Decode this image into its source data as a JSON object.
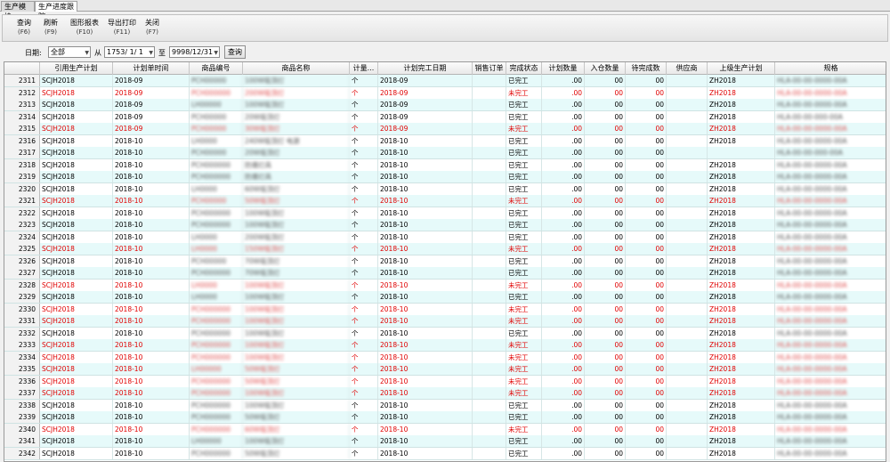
{
  "tabs": [
    {
      "label": "生产模块"
    },
    {
      "label": "生产进度跟踪"
    }
  ],
  "toolbar": {
    "buttons": [
      {
        "label": "查询",
        "key": "(F6)"
      },
      {
        "label": "刷新",
        "key": "(F9)"
      },
      {
        "label": "图形报表",
        "key": "(F10)"
      },
      {
        "label": "导出打印",
        "key": "(F11)"
      },
      {
        "label": "关闭",
        "key": "(F7)"
      }
    ]
  },
  "filter": {
    "date_label": "日期:",
    "range_value": "全部",
    "from_label": "从",
    "from_date": "1753/ 1/ 1",
    "to_label": "至",
    "to_date": "9998/12/31",
    "query_label": "查询"
  },
  "columns": [
    "引用生产计划",
    "计划单时间",
    "商品编号",
    "商品名称",
    "计量...",
    "计划完工日期",
    "销售订单",
    "完成状态",
    "计划数量",
    "入仓数量",
    "待完成数",
    "供应商",
    "上级生产计划",
    "规格"
  ],
  "rows": [
    {
      "n": "2311",
      "plan": "SCJH2018",
      "time": "2018-09",
      "code": "PCH00000",
      "name": "100W吸顶灯",
      "unit": "个",
      "date": "2018-09",
      "status": "已完工",
      "qty": ".00",
      "in": "00",
      "todo": "00",
      "parent": "ZH2018",
      "spec": "HLA-00-00-0000-00A",
      "red": false
    },
    {
      "n": "2312",
      "plan": "SCJH2018",
      "time": "2018-09",
      "code": "PCH000000",
      "name": "200W吸顶灯",
      "unit": "个",
      "date": "2018-09",
      "status": "未完工",
      "qty": ".00",
      "in": "00",
      "todo": "00",
      "parent": "ZH2018",
      "spec": "HLA-00-00-0000-00A",
      "red": true
    },
    {
      "n": "2313",
      "plan": "SCJH2018",
      "time": "2018-09",
      "code": "LH00000",
      "name": "100W吸顶灯",
      "unit": "个",
      "date": "2018-09",
      "status": "已完工",
      "qty": ".00",
      "in": "00",
      "todo": "00",
      "parent": "ZH2018",
      "spec": "HLA-00-00-0000-00A",
      "red": false
    },
    {
      "n": "2314",
      "plan": "SCJH2018",
      "time": "2018-09",
      "code": "PCH00000",
      "name": "20W吸顶灯",
      "unit": "个",
      "date": "2018-09",
      "status": "已完工",
      "qty": ".00",
      "in": "00",
      "todo": "00",
      "parent": "ZH2018",
      "spec": "HLA-00-00-000-00A",
      "red": false
    },
    {
      "n": "2315",
      "plan": "SCJH2018",
      "time": "2018-09",
      "code": "PCH00000",
      "name": "30W吸顶灯",
      "unit": "个",
      "date": "2018-09",
      "status": "未完工",
      "qty": ".00",
      "in": "00",
      "todo": "00",
      "parent": "ZH2018",
      "spec": "HLA-00-00-0000-00A",
      "red": true
    },
    {
      "n": "2316",
      "plan": "SCJH2018",
      "time": "2018-10",
      "code": "LH0000",
      "name": "240W吸顶灯 电源",
      "unit": "个",
      "date": "2018-10",
      "status": "已完工",
      "qty": ".00",
      "in": "00",
      "todo": "00",
      "parent": "ZH2018",
      "spec": "HLA-00-00-0000-00A",
      "red": false
    },
    {
      "n": "2317",
      "plan": "SCJH2018",
      "time": "2018-10",
      "code": "PCH00000",
      "name": "20W吸顶灯",
      "unit": "个",
      "date": "2018-10",
      "status": "已完工",
      "qty": ".00",
      "in": "00",
      "todo": "00",
      "parent": "",
      "spec": "HLA-00-00-000-00A",
      "red": false
    },
    {
      "n": "2318",
      "plan": "SCJH2018",
      "time": "2018-10",
      "code": "PCH000000",
      "name": "防爆灯具",
      "unit": "个",
      "date": "2018-10",
      "status": "已完工",
      "qty": ".00",
      "in": "00",
      "todo": "00",
      "parent": "ZH2018",
      "spec": "HLA-00-00-0000-00A",
      "red": false
    },
    {
      "n": "2319",
      "plan": "SCJH2018",
      "time": "2018-10",
      "code": "PCH000000",
      "name": "防爆灯具",
      "unit": "个",
      "date": "2018-10",
      "status": "已完工",
      "qty": ".00",
      "in": "00",
      "todo": "00",
      "parent": "ZH2018",
      "spec": "HLA-00-00-0000-00A",
      "red": false
    },
    {
      "n": "2320",
      "plan": "SCJH2018",
      "time": "2018-10",
      "code": "LH0000",
      "name": "60W吸顶灯",
      "unit": "个",
      "date": "2018-10",
      "status": "已完工",
      "qty": ".00",
      "in": "00",
      "todo": "00",
      "parent": "ZH2018",
      "spec": "HLA-00-00-0000-00A",
      "red": false
    },
    {
      "n": "2321",
      "plan": "SCJH2018",
      "time": "2018-10",
      "code": "PCH00000",
      "name": "50W吸顶灯",
      "unit": "个",
      "date": "2018-10",
      "status": "未完工",
      "qty": ".00",
      "in": "00",
      "todo": "00",
      "parent": "ZH2018",
      "spec": "HLA-00-00-0000-00A",
      "red": true
    },
    {
      "n": "2322",
      "plan": "SCJH2018",
      "time": "2018-10",
      "code": "PCH000000",
      "name": "100W吸顶灯",
      "unit": "个",
      "date": "2018-10",
      "status": "已完工",
      "qty": ".00",
      "in": "00",
      "todo": "00",
      "parent": "ZH2018",
      "spec": "HLA-00-00-0000-00A",
      "red": false
    },
    {
      "n": "2323",
      "plan": "SCJH2018",
      "time": "2018-10",
      "code": "PCH000000",
      "name": "100W吸顶灯",
      "unit": "个",
      "date": "2018-10",
      "status": "已完工",
      "qty": ".00",
      "in": "00",
      "todo": "00",
      "parent": "ZH2018",
      "spec": "HLA-00-00-0000-00A",
      "red": false
    },
    {
      "n": "2324",
      "plan": "SCJH2018",
      "time": "2018-10",
      "code": "LH0000",
      "name": "200W吸顶灯",
      "unit": "个",
      "date": "2018-10",
      "status": "已完工",
      "qty": ".00",
      "in": "00",
      "todo": "00",
      "parent": "ZH2018",
      "spec": "HLA-00-00-0000-00A",
      "red": false
    },
    {
      "n": "2325",
      "plan": "SCJH2018",
      "time": "2018-10",
      "code": "LH0000",
      "name": "150W吸顶灯",
      "unit": "个",
      "date": "2018-10",
      "status": "未完工",
      "qty": ".00",
      "in": "00",
      "todo": "00",
      "parent": "ZH2018",
      "spec": "HLA-00-00-0000-00A",
      "red": true
    },
    {
      "n": "2326",
      "plan": "SCJH2018",
      "time": "2018-10",
      "code": "PCH00000",
      "name": "70W吸顶灯",
      "unit": "个",
      "date": "2018-10",
      "status": "已完工",
      "qty": ".00",
      "in": "00",
      "todo": "00",
      "parent": "ZH2018",
      "spec": "HLA-00-00-0000-00A",
      "red": false
    },
    {
      "n": "2327",
      "plan": "SCJH2018",
      "time": "2018-10",
      "code": "PCH000000",
      "name": "70W吸顶灯",
      "unit": "个",
      "date": "2018-10",
      "status": "已完工",
      "qty": ".00",
      "in": "00",
      "todo": "00",
      "parent": "ZH2018",
      "spec": "HLA-00-00-0000-00A",
      "red": false
    },
    {
      "n": "2328",
      "plan": "SCJH2018",
      "time": "2018-10",
      "code": "LH0000",
      "name": "100W吸顶灯",
      "unit": "个",
      "date": "2018-10",
      "status": "未完工",
      "qty": ".00",
      "in": "00",
      "todo": "00",
      "parent": "ZH2018",
      "spec": "HLA-00-00-0000-00A",
      "red": true
    },
    {
      "n": "2329",
      "plan": "SCJH2018",
      "time": "2018-10",
      "code": "LH0000",
      "name": "100W吸顶灯",
      "unit": "个",
      "date": "2018-10",
      "status": "已完工",
      "qty": ".00",
      "in": "00",
      "todo": "00",
      "parent": "ZH2018",
      "spec": "HLA-00-00-0000-00A",
      "red": false
    },
    {
      "n": "2330",
      "plan": "SCJH2018",
      "time": "2018-10",
      "code": "PCH000000",
      "name": "100W吸顶灯",
      "unit": "个",
      "date": "2018-10",
      "status": "未完工",
      "qty": ".00",
      "in": "00",
      "todo": "00",
      "parent": "ZH2018",
      "spec": "HLA-00-00-0000-00A",
      "red": true
    },
    {
      "n": "2331",
      "plan": "SCJH2018",
      "time": "2018-10",
      "code": "PCH000000",
      "name": "100W吸顶灯",
      "unit": "个",
      "date": "2018-10",
      "status": "未完工",
      "qty": ".00",
      "in": "00",
      "todo": "00",
      "parent": "ZH2018",
      "spec": "HLA-00-00-0000-00A",
      "red": true
    },
    {
      "n": "2332",
      "plan": "SCJH2018",
      "time": "2018-10",
      "code": "PCH000000",
      "name": "100W吸顶灯",
      "unit": "个",
      "date": "2018-10",
      "status": "已完工",
      "qty": ".00",
      "in": "00",
      "todo": "00",
      "parent": "ZH2018",
      "spec": "HLA-00-00-0000-00A",
      "red": false
    },
    {
      "n": "2333",
      "plan": "SCJH2018",
      "time": "2018-10",
      "code": "PCH000000",
      "name": "100W吸顶灯",
      "unit": "个",
      "date": "2018-10",
      "status": "未完工",
      "qty": ".00",
      "in": "00",
      "todo": "00",
      "parent": "ZH2018",
      "spec": "HLA-00-00-0000-00A",
      "red": true
    },
    {
      "n": "2334",
      "plan": "SCJH2018",
      "time": "2018-10",
      "code": "PCH000000",
      "name": "100W吸顶灯",
      "unit": "个",
      "date": "2018-10",
      "status": "未完工",
      "qty": ".00",
      "in": "00",
      "todo": "00",
      "parent": "ZH2018",
      "spec": "HLA-00-00-0000-00A",
      "red": true
    },
    {
      "n": "2335",
      "plan": "SCJH2018",
      "time": "2018-10",
      "code": "LH00000",
      "name": "50W吸顶灯",
      "unit": "个",
      "date": "2018-10",
      "status": "未完工",
      "qty": ".00",
      "in": "00",
      "todo": "00",
      "parent": "ZH2018",
      "spec": "HLA-00-00-0000-00A",
      "red": true
    },
    {
      "n": "2336",
      "plan": "SCJH2018",
      "time": "2018-10",
      "code": "PCH000000",
      "name": "50W吸顶灯",
      "unit": "个",
      "date": "2018-10",
      "status": "未完工",
      "qty": ".00",
      "in": "00",
      "todo": "00",
      "parent": "ZH2018",
      "spec": "HLA-00-00-0000-00A",
      "red": true
    },
    {
      "n": "2337",
      "plan": "SCJH2018",
      "time": "2018-10",
      "code": "PCH000000",
      "name": "100W吸顶灯",
      "unit": "个",
      "date": "2018-10",
      "status": "未完工",
      "qty": ".00",
      "in": "00",
      "todo": "00",
      "parent": "ZH2018",
      "spec": "HLA-00-00-0000-00A",
      "red": true
    },
    {
      "n": "2338",
      "plan": "SCJH2018",
      "time": "2018-10",
      "code": "PCH000000",
      "name": "100W吸顶灯",
      "unit": "个",
      "date": "2018-10",
      "status": "已完工",
      "qty": ".00",
      "in": "00",
      "todo": "00",
      "parent": "ZH2018",
      "spec": "HLA-00-00-0000-00A",
      "red": false
    },
    {
      "n": "2339",
      "plan": "SCJH2018",
      "time": "2018-10",
      "code": "PCH000000",
      "name": "50W吸顶灯",
      "unit": "个",
      "date": "2018-10",
      "status": "已完工",
      "qty": ".00",
      "in": "00",
      "todo": "00",
      "parent": "ZH2018",
      "spec": "HLA-00-00-0000-00A",
      "red": false
    },
    {
      "n": "2340",
      "plan": "SCJH2018",
      "time": "2018-10",
      "code": "PCH000000",
      "name": "60W吸顶灯",
      "unit": "个",
      "date": "2018-10",
      "status": "未完工",
      "qty": ".00",
      "in": "00",
      "todo": "00",
      "parent": "ZH2018",
      "spec": "HLA-00-00-0000-00A",
      "red": true
    },
    {
      "n": "2341",
      "plan": "SCJH2018",
      "time": "2018-10",
      "code": "LH00000",
      "name": "100W吸顶灯",
      "unit": "个",
      "date": "2018-10",
      "status": "已完工",
      "qty": ".00",
      "in": "00",
      "todo": "00",
      "parent": "ZH2018",
      "spec": "HLA-00-00-0000-00A",
      "red": false
    },
    {
      "n": "2342",
      "plan": "SCJH2018",
      "time": "2018-10",
      "code": "PCH000000",
      "name": "50W吸顶灯",
      "unit": "个",
      "date": "2018-10",
      "status": "已完工",
      "qty": ".00",
      "in": "00",
      "todo": "00",
      "parent": "ZH2018",
      "spec": "HLA-00-00-0000-00A",
      "red": false
    }
  ]
}
